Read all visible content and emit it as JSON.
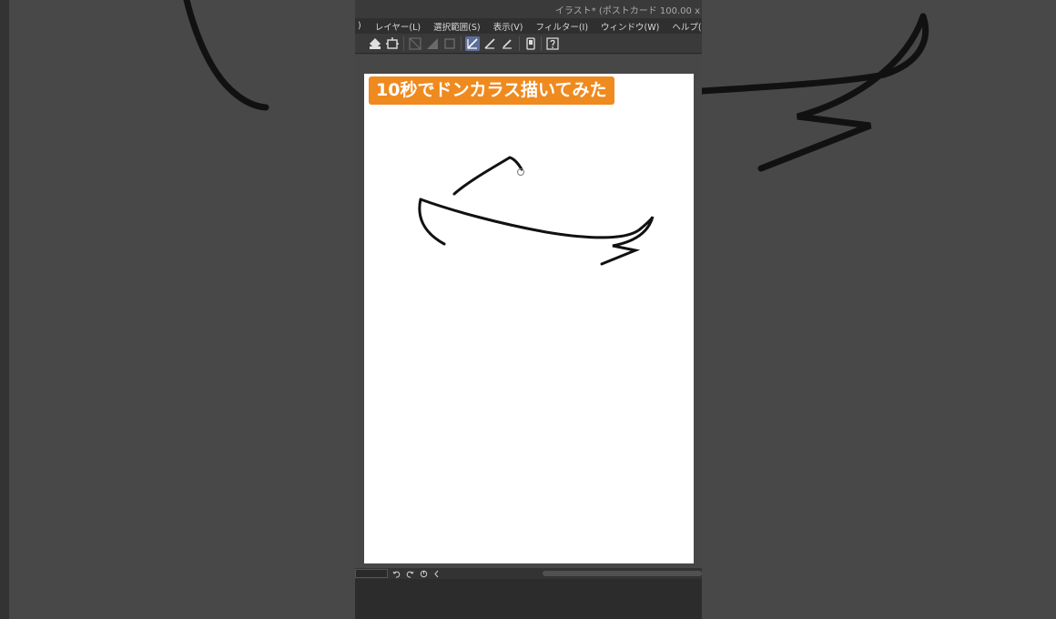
{
  "window": {
    "title": "イラスト* (ポストカード 100.00 x"
  },
  "menu": {
    "items": [
      {
        "label": ")"
      },
      {
        "label": "レイヤー(L)"
      },
      {
        "label": "選択範囲(S)"
      },
      {
        "label": "表示(V)"
      },
      {
        "label": "フィルター(I)"
      },
      {
        "label": "ウィンドウ(W)"
      },
      {
        "label": "ヘルプ(H)"
      }
    ]
  },
  "toolbar": {
    "icons": [
      "fill-icon",
      "transform-icon",
      "ruler-icon",
      "gradient-icon",
      "frame-icon",
      "pen-icon",
      "brush-icon",
      "eraser-icon",
      "phone-icon",
      "help-icon"
    ],
    "active": "pen-icon",
    "active_color": "#5d6f99"
  },
  "canvas": {
    "caption": "10秒でドンカラス描いてみた",
    "caption_color": "#ef8a1f",
    "background": "#ffffff"
  },
  "statusbar": {
    "icons": [
      "undo-icon",
      "redo-icon",
      "rotate-icon",
      "collapse-icon"
    ]
  }
}
